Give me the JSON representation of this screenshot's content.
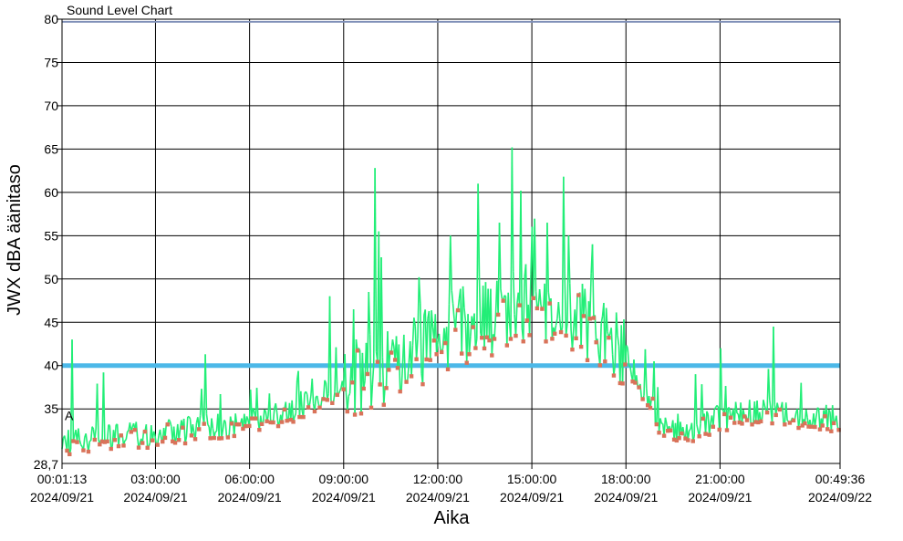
{
  "chart_data": {
    "type": "line",
    "title": "Sound Level Chart",
    "xlabel": "Aika",
    "ylabel": "JWX dBA äänitaso",
    "ylim": [
      28.7,
      80
    ],
    "yticks": [
      80,
      75,
      70,
      65,
      60,
      55,
      50,
      45,
      40,
      35
    ],
    "ymin_label": "28,7",
    "x_range_hours": [
      0.02,
      24.827
    ],
    "xticks": [
      {
        "time": "00:01:13",
        "date": "2024/09/21",
        "h": 0.0203
      },
      {
        "time": "03:00:00",
        "date": "2024/09/21",
        "h": 3
      },
      {
        "time": "06:00:00",
        "date": "2024/09/21",
        "h": 6
      },
      {
        "time": "09:00:00",
        "date": "2024/09/21",
        "h": 9
      },
      {
        "time": "12:00:00",
        "date": "2024/09/21",
        "h": 12
      },
      {
        "time": "15:00:00",
        "date": "2024/09/21",
        "h": 15
      },
      {
        "time": "18:00:00",
        "date": "2024/09/21",
        "h": 18
      },
      {
        "time": "21:00:00",
        "date": "2024/09/21",
        "h": 21
      },
      {
        "time": "00:49:36",
        "date": "2024/09/22",
        "h": 24.827
      }
    ],
    "threshold": {
      "value": 40,
      "color": "#4cb8e8"
    },
    "top_line": {
      "value": 79.7,
      "color": "#8090b8"
    },
    "a_marker": {
      "label": "A",
      "value": 33.5
    },
    "grid": true,
    "series": [
      {
        "line_color": "#22ee77",
        "marker_color": "#d9735a",
        "profile_hours": [
          0,
          1,
          2,
          3,
          4,
          5,
          6,
          7,
          8,
          9,
          10,
          11,
          12,
          13,
          14,
          15,
          16,
          17,
          18,
          19,
          20,
          21,
          22,
          23,
          24,
          24.83
        ],
        "profile_base_db": [
          31.0,
          31.5,
          32.0,
          32.0,
          32.5,
          33.0,
          33.5,
          34.5,
          36.0,
          38.0,
          39.5,
          40.5,
          43.0,
          44.5,
          46.0,
          47.5,
          46.5,
          44.5,
          41.0,
          33.5,
          32.5,
          34.0,
          34.5,
          34.5,
          34.0,
          34.0
        ],
        "samples": 620,
        "peaks": [
          {
            "h": 0.35,
            "v": 43.0
          },
          {
            "h": 1.35,
            "v": 39.2
          },
          {
            "h": 4.6,
            "v": 41.3
          },
          {
            "h": 7.5,
            "v": 38.3
          },
          {
            "h": 8.55,
            "v": 48.0
          },
          {
            "h": 9.3,
            "v": 46.5
          },
          {
            "h": 9.8,
            "v": 48.5
          },
          {
            "h": 10.0,
            "v": 62.8
          },
          {
            "h": 10.1,
            "v": 55.5
          },
          {
            "h": 10.2,
            "v": 52.5
          },
          {
            "h": 11.4,
            "v": 50.2
          },
          {
            "h": 12.4,
            "v": 55.0
          },
          {
            "h": 13.3,
            "v": 61.0
          },
          {
            "h": 13.95,
            "v": 56.5
          },
          {
            "h": 14.35,
            "v": 65.2
          },
          {
            "h": 14.65,
            "v": 60.2
          },
          {
            "h": 15.5,
            "v": 56.5
          },
          {
            "h": 16.0,
            "v": 61.8
          },
          {
            "h": 16.95,
            "v": 54.0
          },
          {
            "h": 18.9,
            "v": 40.5
          },
          {
            "h": 20.2,
            "v": 39.0
          },
          {
            "h": 21.0,
            "v": 42.0
          },
          {
            "h": 22.7,
            "v": 44.5
          },
          {
            "h": 23.6,
            "v": 38.0
          }
        ]
      }
    ]
  }
}
